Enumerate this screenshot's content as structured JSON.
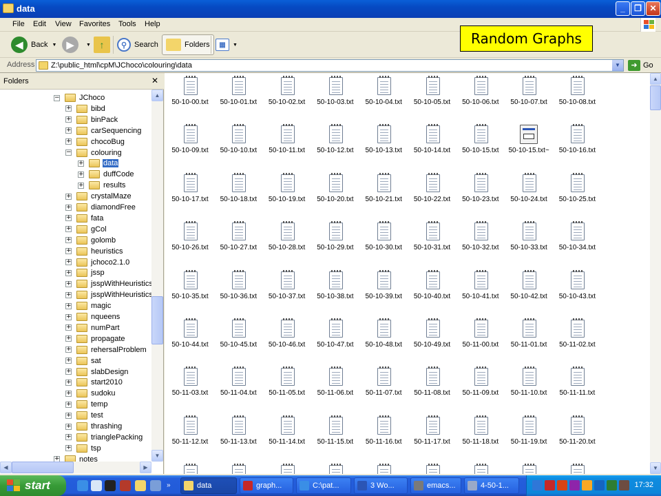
{
  "window": {
    "title": "data"
  },
  "menu": [
    "File",
    "Edit",
    "View",
    "Favorites",
    "Tools",
    "Help"
  ],
  "toolbar": {
    "back_label": "Back",
    "search_label": "Search",
    "folders_label": "Folders"
  },
  "address": {
    "label": "Address",
    "path": "Z:\\public_html\\cpM\\JChoco\\colouring\\data",
    "go_label": "Go"
  },
  "folders_pane": {
    "title": "Folders",
    "tree": [
      {
        "label": "JChoco",
        "level": 0,
        "expander": "−"
      },
      {
        "label": "bibd",
        "level": 1,
        "expander": "+"
      },
      {
        "label": "binPack",
        "level": 1,
        "expander": "+"
      },
      {
        "label": "carSequencing",
        "level": 1,
        "expander": "+"
      },
      {
        "label": "chocoBug",
        "level": 1,
        "expander": "+"
      },
      {
        "label": "colouring",
        "level": 1,
        "expander": "−"
      },
      {
        "label": "data",
        "level": 2,
        "expander": "+",
        "selected": true
      },
      {
        "label": "duffCode",
        "level": 2,
        "expander": "+"
      },
      {
        "label": "results",
        "level": 2,
        "expander": "+"
      },
      {
        "label": "crystalMaze",
        "level": 1,
        "expander": "+"
      },
      {
        "label": "diamondFree",
        "level": 1,
        "expander": "+"
      },
      {
        "label": "fata",
        "level": 1,
        "expander": "+"
      },
      {
        "label": "gCol",
        "level": 1,
        "expander": "+"
      },
      {
        "label": "golomb",
        "level": 1,
        "expander": "+"
      },
      {
        "label": "heuristics",
        "level": 1,
        "expander": "+"
      },
      {
        "label": "jchoco2.1.0",
        "level": 1,
        "expander": "+"
      },
      {
        "label": "jssp",
        "level": 1,
        "expander": "+"
      },
      {
        "label": "jsspWithHeuristics",
        "level": 1,
        "expander": "+"
      },
      {
        "label": "jsspWithHeuristicsOl",
        "level": 1,
        "expander": "+"
      },
      {
        "label": "magic",
        "level": 1,
        "expander": "+"
      },
      {
        "label": "nqueens",
        "level": 1,
        "expander": "+"
      },
      {
        "label": "numPart",
        "level": 1,
        "expander": "+"
      },
      {
        "label": "propagate",
        "level": 1,
        "expander": "+"
      },
      {
        "label": "rehersalProblem",
        "level": 1,
        "expander": "+"
      },
      {
        "label": "sat",
        "level": 1,
        "expander": "+"
      },
      {
        "label": "slabDesign",
        "level": 1,
        "expander": "+"
      },
      {
        "label": "start2010",
        "level": 1,
        "expander": "+"
      },
      {
        "label": "sudoku",
        "level": 1,
        "expander": "+"
      },
      {
        "label": "temp",
        "level": 1,
        "expander": "+"
      },
      {
        "label": "test",
        "level": 1,
        "expander": "+"
      },
      {
        "label": "thrashing",
        "level": 1,
        "expander": "+"
      },
      {
        "label": "trianglePacking",
        "level": 1,
        "expander": "+"
      },
      {
        "label": "tsp",
        "level": 1,
        "expander": "+"
      },
      {
        "label": "notes",
        "level": 0,
        "expander": "+"
      }
    ]
  },
  "files": [
    "50-10-00.txt",
    "50-10-01.txt",
    "50-10-02.txt",
    "50-10-03.txt",
    "50-10-04.txt",
    "50-10-05.txt",
    "50-10-06.txt",
    "50-10-07.txt",
    "50-10-08.txt",
    "50-10-09.txt",
    "50-10-10.txt",
    "50-10-11.txt",
    "50-10-12.txt",
    "50-10-13.txt",
    "50-10-14.txt",
    "50-10-15.txt",
    "50-10-15.txt~",
    "50-10-16.txt",
    "50-10-17.txt",
    "50-10-18.txt",
    "50-10-19.txt",
    "50-10-20.txt",
    "50-10-21.txt",
    "50-10-22.txt",
    "50-10-23.txt",
    "50-10-24.txt",
    "50-10-25.txt",
    "50-10-26.txt",
    "50-10-27.txt",
    "50-10-28.txt",
    "50-10-29.txt",
    "50-10-30.txt",
    "50-10-31.txt",
    "50-10-32.txt",
    "50-10-33.txt",
    "50-10-34.txt",
    "50-10-35.txt",
    "50-10-36.txt",
    "50-10-37.txt",
    "50-10-38.txt",
    "50-10-39.txt",
    "50-10-40.txt",
    "50-10-41.txt",
    "50-10-42.txt",
    "50-10-43.txt",
    "50-10-44.txt",
    "50-10-45.txt",
    "50-10-46.txt",
    "50-10-47.txt",
    "50-10-48.txt",
    "50-10-49.txt",
    "50-11-00.txt",
    "50-11-01.txt",
    "50-11-02.txt",
    "50-11-03.txt",
    "50-11-04.txt",
    "50-11-05.txt",
    "50-11-06.txt",
    "50-11-07.txt",
    "50-11-08.txt",
    "50-11-09.txt",
    "50-11-10.txt",
    "50-11-11.txt",
    "50-11-12.txt",
    "50-11-13.txt",
    "50-11-14.txt",
    "50-11-15.txt",
    "50-11-16.txt",
    "50-11-17.txt",
    "50-11-18.txt",
    "50-11-19.txt",
    "50-11-20.txt",
    "",
    "",
    "",
    "",
    "",
    "",
    "",
    "",
    ""
  ],
  "special_file": "50-10-15.txt~",
  "overlay_label": "Random Graphs",
  "taskbar": {
    "start_label": "start",
    "tasks": [
      {
        "label": "data",
        "icon": "folder-icon",
        "active": true
      },
      {
        "label": "graph...",
        "icon": "app-icon",
        "active": false
      },
      {
        "label": "C:\\pat...",
        "icon": "ie-icon",
        "active": false
      },
      {
        "label": "3 Wo...",
        "icon": "word-icon",
        "active": false
      },
      {
        "label": "emacs...",
        "icon": "emacs-icon",
        "active": false
      },
      {
        "label": "4-50-1...",
        "icon": "window-icon",
        "active": false
      }
    ],
    "clock": "17:32"
  },
  "colors": {
    "titlebar": "#0A5FD8",
    "selection": "#316AC5",
    "overlay_bg": "#FFFF00",
    "taskbar": "#245EDC",
    "start": "#379B37"
  }
}
